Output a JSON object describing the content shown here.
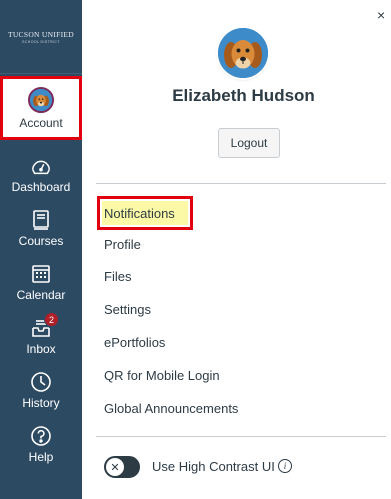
{
  "brand": {
    "line1": "TUCSON UNIFIED",
    "line2": "SCHOOL DISTRICT"
  },
  "nav": {
    "account": "Account",
    "dashboard": "Dashboard",
    "courses": "Courses",
    "calendar": "Calendar",
    "inbox": "Inbox",
    "inbox_badge": "2",
    "history": "History",
    "help": "Help"
  },
  "tray": {
    "close": "×",
    "user_name": "Elizabeth Hudson",
    "logout": "Logout",
    "links": {
      "notifications": "Notifications",
      "profile": "Profile",
      "files": "Files",
      "settings": "Settings",
      "eportfolios": "ePortfolios",
      "qr": "QR for Mobile Login",
      "announcements": "Global Announcements"
    },
    "high_contrast": "Use High Contrast UI",
    "toggle_symbol": "✕",
    "info_symbol": "i"
  },
  "colors": {
    "nav_bg": "#2d4a63",
    "highlight_border": "#e0000f",
    "notification_highlight": "#fbf9a5",
    "badge": "#b01e27",
    "text": "#2d3b45"
  }
}
